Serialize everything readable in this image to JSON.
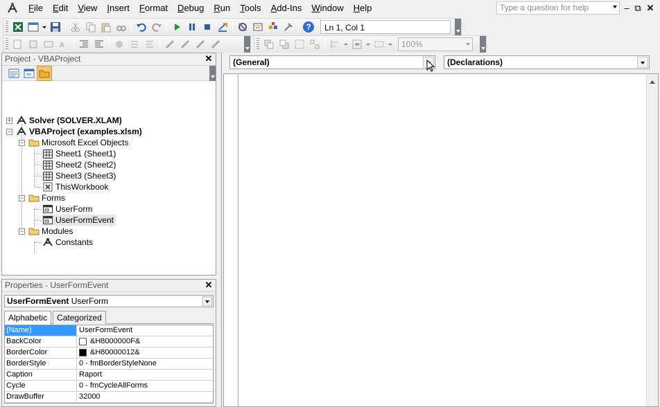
{
  "menu": [
    "File",
    "Edit",
    "View",
    "Insert",
    "Format",
    "Debug",
    "Run",
    "Tools",
    "Add-Ins",
    "Window",
    "Help"
  ],
  "help_box": {
    "placeholder": "Type a question for help"
  },
  "toolbar": {
    "position": "Ln 1, Col 1",
    "zoom": "100%"
  },
  "project": {
    "title": "Project - VBAProject",
    "tree": [
      {
        "label": "Solver (SOLVER.XLAM)",
        "bold": true
      },
      {
        "label": "VBAProject (examples.xlsm)",
        "bold": true
      },
      {
        "label": "Microsoft Excel Objects"
      },
      {
        "label": "Sheet1 (Sheet1)"
      },
      {
        "label": "Sheet2 (Sheet2)"
      },
      {
        "label": "Sheet3 (Sheet3)"
      },
      {
        "label": "ThisWorkbook"
      },
      {
        "label": "Forms"
      },
      {
        "label": "UserForm"
      },
      {
        "label": "UserFormEvent",
        "selected": true
      },
      {
        "label": "Modules"
      },
      {
        "label": "Constants"
      }
    ]
  },
  "properties": {
    "title": "Properties - UserFormEvent",
    "object_name": "UserFormEvent",
    "object_type": "UserForm",
    "tabs": [
      "Alphabetic",
      "Categorized"
    ],
    "rows": [
      {
        "name": "(Name)",
        "value": "UserFormEvent",
        "selected": true
      },
      {
        "name": "BackColor",
        "value": "&H8000000F&",
        "swatch": "#ffffff"
      },
      {
        "name": "BorderColor",
        "value": "&H80000012&",
        "swatch": "#000000"
      },
      {
        "name": "BorderStyle",
        "value": "0 - fmBorderStyleNone"
      },
      {
        "name": "Caption",
        "value": "Raport"
      },
      {
        "name": "Cycle",
        "value": "0 - fmCycleAllForms"
      },
      {
        "name": "DrawBuffer",
        "value": "32000"
      }
    ]
  },
  "code": {
    "object_combo": "(General)",
    "procedure_combo": "(Declarations)"
  },
  "colors": {
    "selection": "#3399ff"
  }
}
